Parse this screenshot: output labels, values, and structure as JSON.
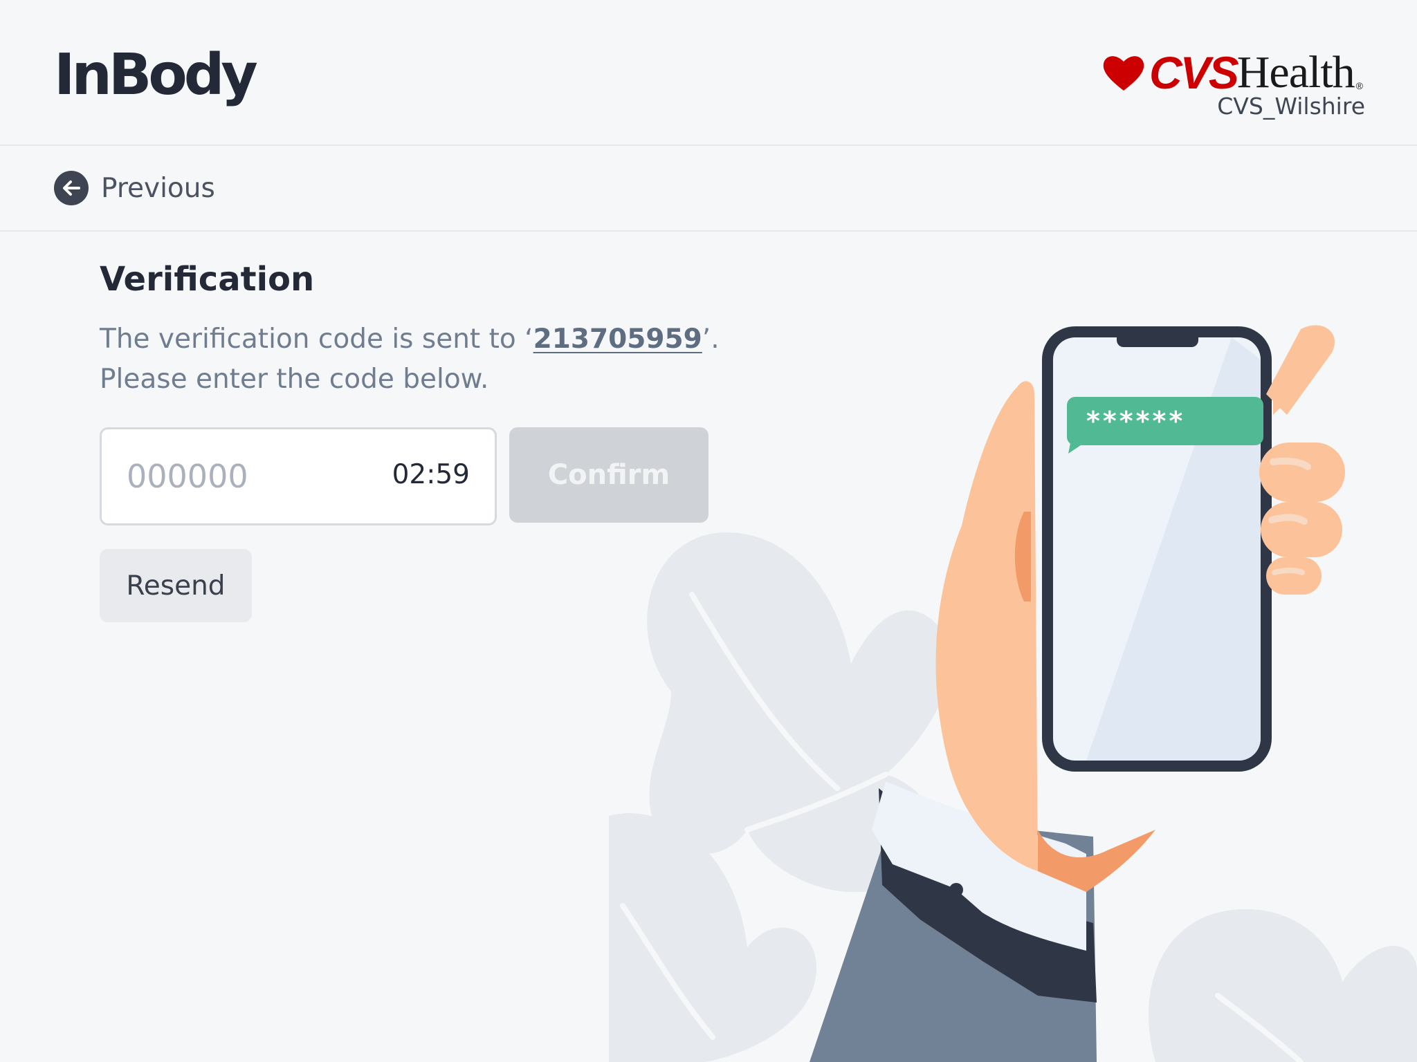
{
  "header": {
    "app_logo": "InBody",
    "partner_brand": "CVS",
    "partner_brand_suffix": "Health",
    "partner_reg_mark": "®",
    "store_name": "CVS_Wilshire"
  },
  "nav": {
    "previous_label": "Previous"
  },
  "verification": {
    "title": "Verification",
    "desc_prefix": "The verification code is sent to ‘",
    "phone": "213705959",
    "desc_suffix": "’.",
    "desc_line2": "Please enter the code below.",
    "code_placeholder": "000000",
    "code_value": "",
    "timer": "02:59",
    "confirm_label": "Confirm",
    "resend_label": "Resend"
  },
  "illustration": {
    "message_text": "******"
  },
  "colors": {
    "background": "#f6f7f9",
    "brand_red": "#cc0000",
    "message_green": "#52b995",
    "confirm_disabled": "#cfd2d7"
  }
}
